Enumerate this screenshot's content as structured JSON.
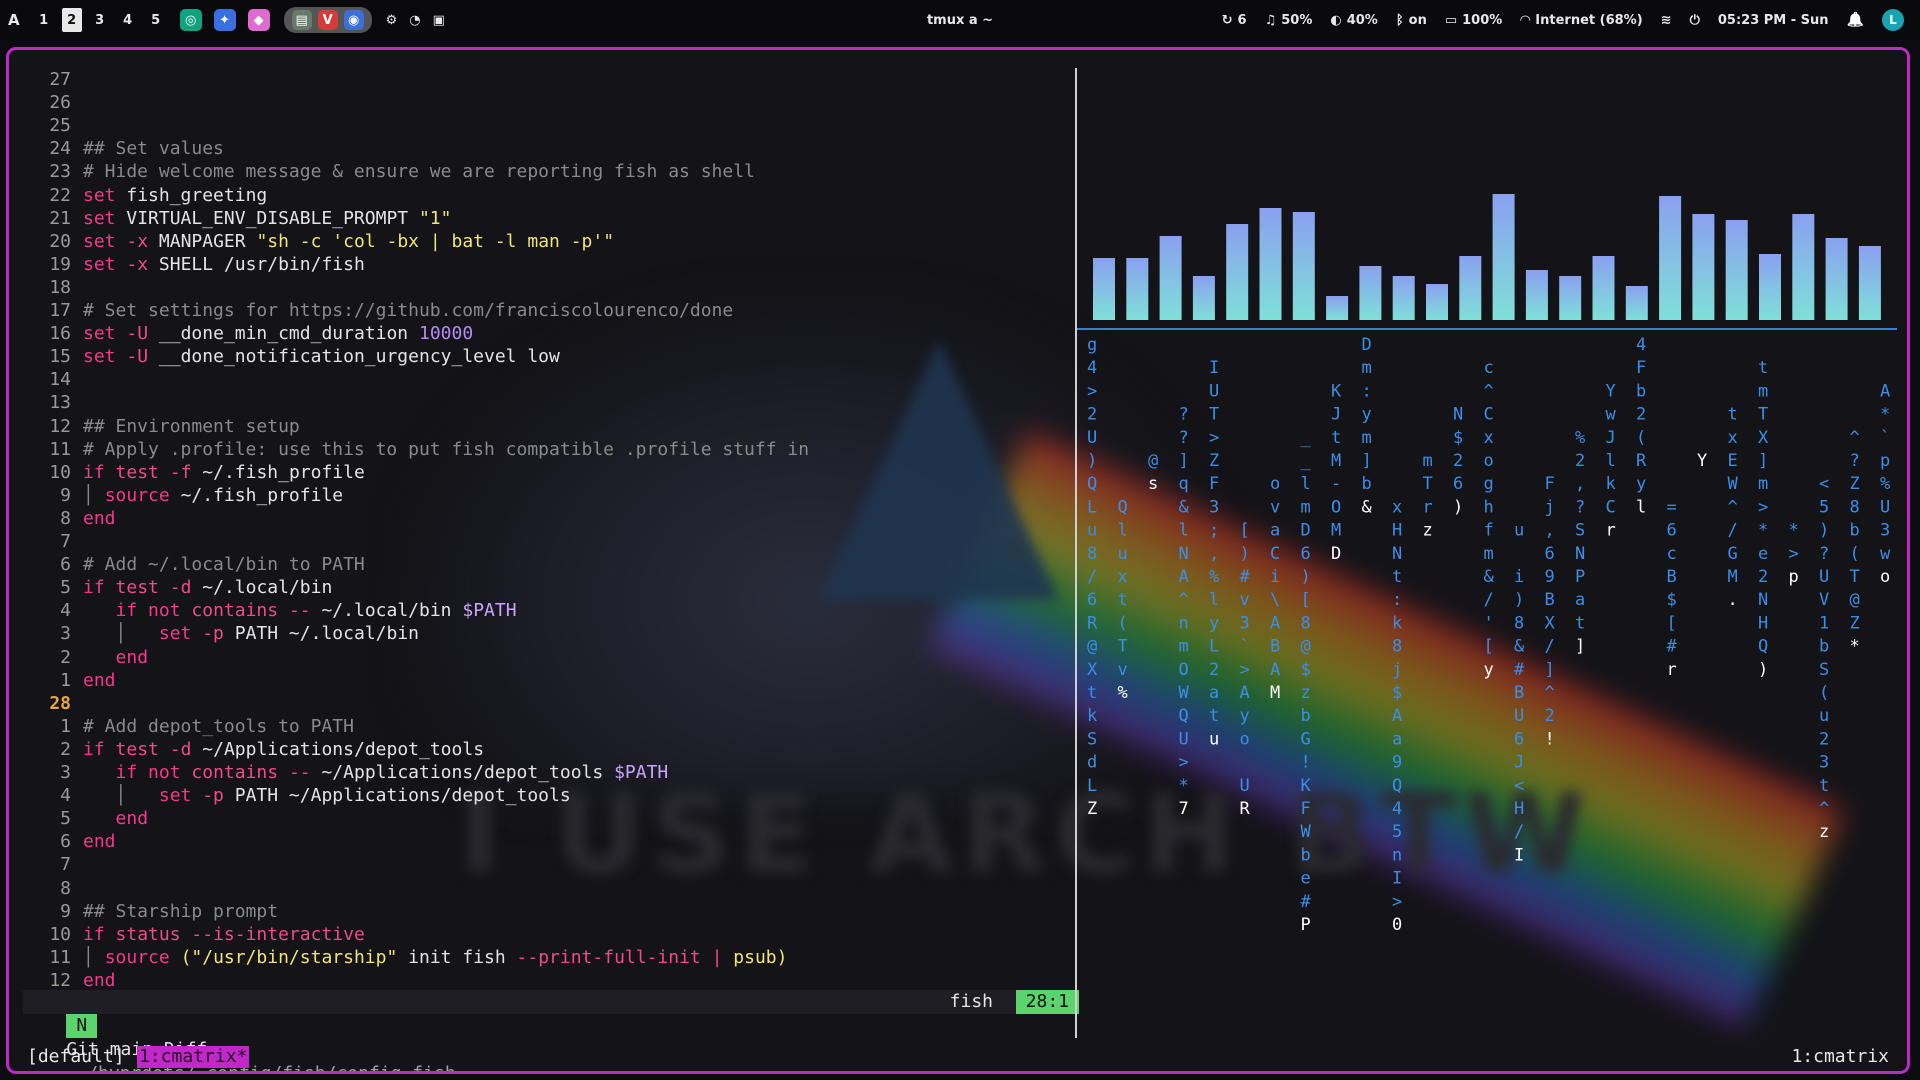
{
  "topbar": {
    "arch_glyph": "A",
    "workspaces": [
      "1",
      "2",
      "3",
      "4",
      "5"
    ],
    "active_workspace": "2",
    "apps": [
      {
        "name": "chatgpt-icon",
        "glyph": "◎",
        "color": "#10a37f"
      },
      {
        "name": "gemini-icon",
        "glyph": "✦",
        "color": "#3b6fe0"
      },
      {
        "name": "copilot-icon",
        "glyph": "◆",
        "color": "#e06bd0"
      }
    ],
    "pill_apps": [
      {
        "name": "files-icon",
        "glyph": "▤",
        "color": "#6a7a6a"
      },
      {
        "name": "vivaldi-icon",
        "glyph": "V",
        "color": "#d63a3a"
      },
      {
        "name": "chromium-icon",
        "glyph": "◉",
        "color": "#3c6fd8"
      }
    ],
    "tray_glyphs": [
      "⚙",
      "◔",
      "▣"
    ],
    "title": "tmux a ~",
    "stats": [
      {
        "name": "updates",
        "icon": "↻",
        "value": "6"
      },
      {
        "name": "volume",
        "icon": "♫",
        "value": "50%"
      },
      {
        "name": "brightness",
        "icon": "◐",
        "value": "40%"
      },
      {
        "name": "bluetooth",
        "icon": "ᛒ",
        "value": "on"
      },
      {
        "name": "battery",
        "icon": "▭",
        "value": "100%"
      },
      {
        "name": "network",
        "icon": "◠",
        "value": "Internet (68%)"
      },
      {
        "name": "layers",
        "icon": "≋",
        "value": ""
      },
      {
        "name": "power",
        "icon": "⏻",
        "value": ""
      },
      {
        "name": "clock",
        "icon": "",
        "value": "05:23 PM - Sun"
      }
    ],
    "bell": "🔔",
    "avatar": "L"
  },
  "editor": {
    "lines": [
      {
        "n": "27",
        "t": []
      },
      {
        "n": "26",
        "t": []
      },
      {
        "n": "25",
        "t": []
      },
      {
        "n": "24",
        "t": [
          [
            "cm",
            "## Set values"
          ]
        ]
      },
      {
        "n": "23",
        "t": [
          [
            "cm",
            "# Hide welcome message & ensure we are reporting fish as shell"
          ]
        ]
      },
      {
        "n": "22",
        "t": [
          [
            "kw",
            "set"
          ],
          [
            "",
            "fish_greeting"
          ]
        ]
      },
      {
        "n": "21",
        "t": [
          [
            "kw",
            "set"
          ],
          [
            "",
            "VIRTUAL_ENV_DISABLE_PROMPT "
          ],
          [
            "str",
            "\"1\""
          ]
        ]
      },
      {
        "n": "20",
        "t": [
          [
            "kw",
            "set"
          ],
          [
            "op",
            "-x"
          ],
          [
            "",
            "MANPAGER "
          ],
          [
            "str",
            "\"sh -c 'col -bx | bat -l man -p'\""
          ]
        ]
      },
      {
        "n": "19",
        "t": [
          [
            "kw",
            "set"
          ],
          [
            "op",
            "-x"
          ],
          [
            "",
            "SHELL /usr/bin/fish"
          ]
        ]
      },
      {
        "n": "18",
        "t": []
      },
      {
        "n": "17",
        "t": [
          [
            "cm",
            "# Set settings for https://github.com/franciscolourenco/done"
          ]
        ]
      },
      {
        "n": "16",
        "t": [
          [
            "kw",
            "set"
          ],
          [
            "op",
            "-U"
          ],
          [
            "",
            "__done_min_cmd_duration "
          ],
          [
            "num",
            "10000"
          ]
        ]
      },
      {
        "n": "15",
        "t": [
          [
            "kw",
            "set"
          ],
          [
            "op",
            "-U"
          ],
          [
            "",
            "__done_notification_urgency_level low"
          ]
        ]
      },
      {
        "n": "14",
        "t": []
      },
      {
        "n": "13",
        "t": []
      },
      {
        "n": "12",
        "t": [
          [
            "cm",
            "## Environment setup"
          ]
        ]
      },
      {
        "n": "11",
        "t": [
          [
            "cm",
            "# Apply .profile: use this to put fish compatible .profile stuff in"
          ]
        ]
      },
      {
        "n": "10",
        "t": [
          [
            "kw",
            "if"
          ],
          [
            "fn",
            "test"
          ],
          [
            "op",
            "-f"
          ],
          [
            "",
            "~/.fish_profile"
          ]
        ]
      },
      {
        "n": "9",
        "t": [
          [
            "cm",
            "│ "
          ],
          [
            "kw",
            "source"
          ],
          [
            "",
            "~/.fish_profile"
          ]
        ]
      },
      {
        "n": "8",
        "t": [
          [
            "kw",
            "end"
          ]
        ]
      },
      {
        "n": "7",
        "t": []
      },
      {
        "n": "6",
        "t": [
          [
            "cm",
            "# Add ~/.local/bin to PATH"
          ]
        ]
      },
      {
        "n": "5",
        "t": [
          [
            "kw",
            "if"
          ],
          [
            "fn",
            "test"
          ],
          [
            "op",
            "-d"
          ],
          [
            "",
            "~/.local/bin"
          ]
        ]
      },
      {
        "n": "4",
        "t": [
          [
            "",
            "   "
          ],
          [
            "kw",
            "if not"
          ],
          [
            "fn",
            "contains"
          ],
          [
            "op",
            "--"
          ],
          [
            "",
            "~/.local/bin "
          ],
          [
            "va",
            "$PATH"
          ]
        ]
      },
      {
        "n": "3",
        "t": [
          [
            "cm",
            "   │   "
          ],
          [
            "kw",
            "set"
          ],
          [
            "op",
            "-p"
          ],
          [
            "",
            "PATH ~/.local/bin"
          ]
        ]
      },
      {
        "n": "2",
        "t": [
          [
            "",
            "   "
          ],
          [
            "kw",
            "end"
          ]
        ]
      },
      {
        "n": "1",
        "t": [
          [
            "kw",
            "end"
          ]
        ]
      },
      {
        "n": "28",
        "cur": true,
        "t": []
      },
      {
        "n": "1",
        "t": [
          [
            "cm",
            "# Add depot_tools to PATH"
          ]
        ]
      },
      {
        "n": "2",
        "t": [
          [
            "kw",
            "if"
          ],
          [
            "fn",
            "test"
          ],
          [
            "op",
            "-d"
          ],
          [
            "",
            "~/Applications/depot_tools"
          ]
        ]
      },
      {
        "n": "3",
        "t": [
          [
            "",
            "   "
          ],
          [
            "kw",
            "if not"
          ],
          [
            "fn",
            "contains"
          ],
          [
            "op",
            "--"
          ],
          [
            "",
            "~/Applications/depot_tools "
          ],
          [
            "va",
            "$PATH"
          ]
        ]
      },
      {
        "n": "4",
        "t": [
          [
            "cm",
            "   │   "
          ],
          [
            "kw",
            "set"
          ],
          [
            "op",
            "-p"
          ],
          [
            "",
            "PATH ~/Applications/depot_tools"
          ]
        ]
      },
      {
        "n": "5",
        "t": [
          [
            "",
            "   "
          ],
          [
            "kw",
            "end"
          ]
        ]
      },
      {
        "n": "6",
        "t": [
          [
            "kw",
            "end"
          ]
        ]
      },
      {
        "n": "7",
        "t": []
      },
      {
        "n": "8",
        "t": []
      },
      {
        "n": "9",
        "t": [
          [
            "cm",
            "## Starship prompt"
          ]
        ]
      },
      {
        "n": "10",
        "t": [
          [
            "kw",
            "if"
          ],
          [
            "fn",
            "status"
          ],
          [
            "op",
            "--is-interactive"
          ]
        ]
      },
      {
        "n": "11",
        "t": [
          [
            "cm",
            "│ "
          ],
          [
            "kw",
            "source"
          ],
          [
            "str",
            "(\"/usr/bin/starship\""
          ],
          [
            "",
            "init fish "
          ],
          [
            "op",
            "--print-full-init"
          ],
          [
            "op",
            "|"
          ],
          [
            "str",
            "psub)"
          ]
        ]
      },
      {
        "n": "12",
        "t": [
          [
            "kw",
            "end"
          ]
        ]
      }
    ],
    "status": {
      "mode": "N",
      "git": "Git main Diff -",
      "path": "~/hyprdots/.config/fish/config.fish",
      "filetype": "fish",
      "position": "28:1"
    }
  },
  "visualizer": {
    "levels": [
      0.31,
      0.31,
      0.42,
      0.22,
      0.48,
      0.56,
      0.54,
      0.12,
      0.27,
      0.22,
      0.18,
      0.32,
      0.63,
      0.25,
      0.22,
      0.32,
      0.17,
      0.62,
      0.53,
      0.5,
      0.33,
      0.53,
      0.41,
      0.37
    ],
    "top_color": "#8aa0f0",
    "bottom_color": "#7fe0d8"
  },
  "matrix": {
    "columns": [
      "g4>2U)QLu8/6R@XtkSdLZ",
      "Qluxt(Tv%",
      "@s",
      "??]q&lNA^nmOWQU>*7",
      "IUT>ZF3;,%lyL2atu",
      "[)#v3`>Ayo UR",
      "ovaCi\\ABAM",
      "__lmD6)[8@$zbG!KFWbe#P",
      "KJtM-OMD",
      "Dm:ym]b&",
      "xHNt:k8j$Aa9Q45nI>0",
      "mTrz",
      "N$26)",
      "c^Cxoghfm&/'[y",
      "u i)8&#BU6J<H/I",
      "Fj,69BX/]^2!",
      "%2,?SNPat]",
      "YwJlkCr",
      "4Fb2(Ryl",
      "=6cB$[#r",
      "Y",
      "txEW^/GM.",
      "tmTX]m>*e2NHQ)",
      "*>p",
      "<5)?UV1bS(u23t^z",
      "^?Z8b(T@Z*",
      "A*`p%U3wo"
    ]
  },
  "tmux": {
    "session": "[default]",
    "window": "1:cmatrix*",
    "right": "1:cmatrix"
  }
}
